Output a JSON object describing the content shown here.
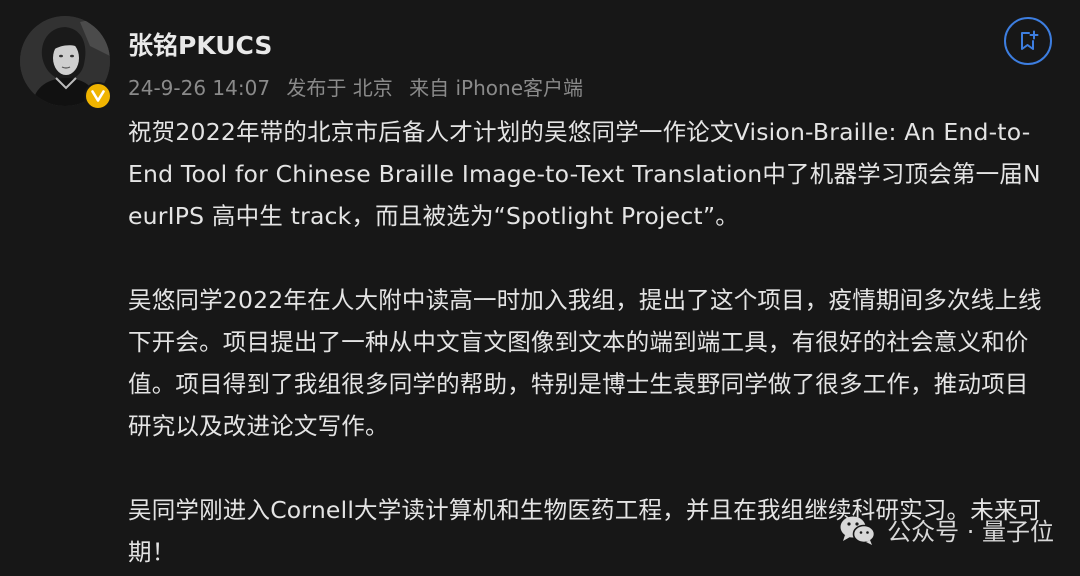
{
  "post": {
    "author": {
      "name": "张铭PKUCS",
      "verified": true,
      "badge_color": "#f0b400",
      "badge_glyph": "v"
    },
    "meta": {
      "time": "24-9-26 14:07",
      "location": "发布于 北京",
      "client": "来自 iPhone客户端"
    },
    "bookmark_icon": "bookmark-add-icon",
    "paragraphs": [
      "祝贺2022年带的北京市后备人才计划的吴悠同学一作论文Vision-Braille: An End-to-End Tool for Chinese Braille Image-to-Text Translation中了机器学习顶会第一届NeurIPS 高中生 track，而且被选为“Spotlight Project”。",
      "吴悠同学2022年在人大附中读高一时加入我组，提出了这个项目，疫情期间多次线上线下开会。项目提出了一种从中文盲文图像到文本的端到端工具，有很好的社会意义和价值。项目得到了我组很多同学的帮助，特别是博士生袁野同学做了很多工作，推动项目研究以及改进论文写作。",
      "吴同学刚进入Cornell大学读计算机和生物医药工程，并且在我组继续科研实习。未来可期！"
    ]
  },
  "watermark": {
    "icon": "wechat-icon",
    "text": "公众号 · 量子位"
  },
  "colors": {
    "background": "#171717",
    "text": "#e4e4e4",
    "meta": "#8a8a8a",
    "accent": "#3d7ee0"
  }
}
